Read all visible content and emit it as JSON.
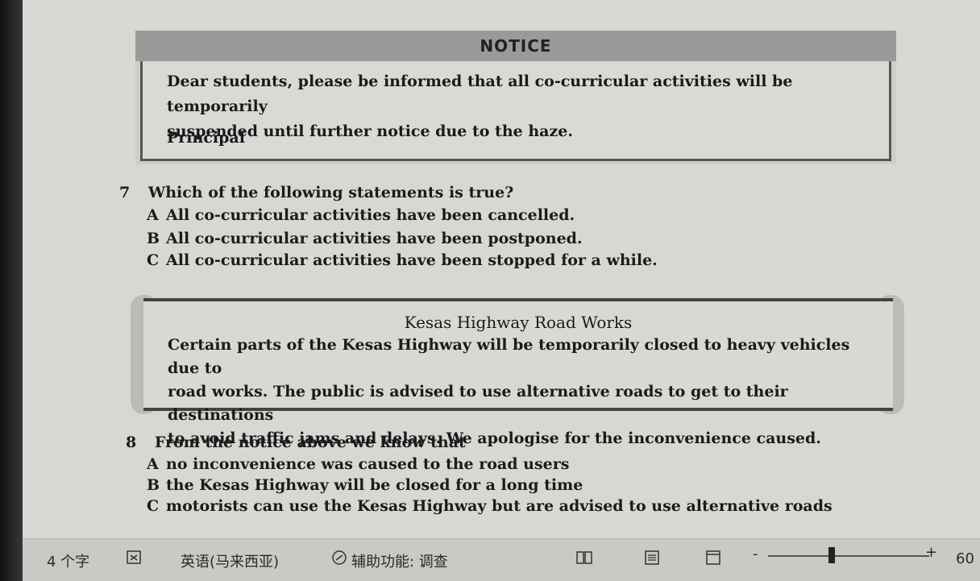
{
  "notice1": {
    "title": "NOTICE",
    "line1": "Dear students, please be informed that all co-curricular activities will be temporarily",
    "line2": "suspended until further notice due to the haze.",
    "signature": "Principal"
  },
  "question7": {
    "number": "7",
    "prompt": "Which of the following statements is true?",
    "options": [
      {
        "letter": "A",
        "text": "All co-curricular activities have been cancelled."
      },
      {
        "letter": "B",
        "text": "All co-curricular activities have been postponed."
      },
      {
        "letter": "C",
        "text": "All co-curricular activities have been stopped for a while."
      }
    ]
  },
  "notice2": {
    "title": "Kesas Highway Road Works",
    "line1": "Certain parts of the Kesas Highway will be temporarily closed to heavy vehicles due to",
    "line2": "road works. The public is advised to use alternative roads to get to their destinations",
    "line3": "to avoid traffic jams and delays. We apologise for the inconvenience caused."
  },
  "question8": {
    "number": "8",
    "prompt": "From the notice above we know that",
    "options": [
      {
        "letter": "A",
        "text": "no inconvenience was caused to the road users"
      },
      {
        "letter": "B",
        "text": "the Kesas Highway will be closed for a long time"
      },
      {
        "letter": "C",
        "text": "motorists can use the Kesas Highway but are advised to use alternative roads"
      }
    ]
  },
  "statusbar": {
    "word_count": "4 个字",
    "language": "英语(马来西亚)",
    "accessibility": "辅助功能: 调查",
    "zoom_minus": "-",
    "zoom_plus": "+",
    "zoom": "60",
    "icons": [
      "proofing-icon",
      "accessibility-icon",
      "read-mode-icon",
      "print-layout-icon",
      "web-layout-icon"
    ],
    "zoom_level_fraction": 0.6
  }
}
